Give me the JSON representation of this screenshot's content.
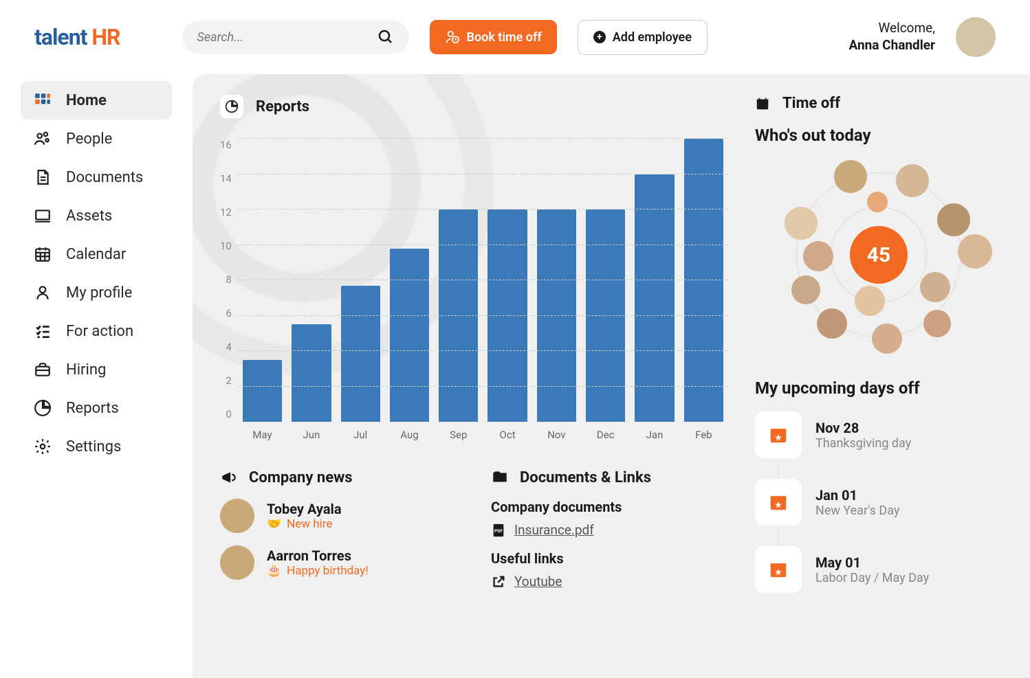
{
  "brand": {
    "part1": "talent",
    "part2": " HR"
  },
  "search": {
    "placeholder": "Search..."
  },
  "actions": {
    "book": "Book time off",
    "add": "Add employee"
  },
  "welcome": {
    "greeting": "Welcome,",
    "name": "Anna Chandler"
  },
  "nav": [
    {
      "label": "Home",
      "active": true
    },
    {
      "label": "People"
    },
    {
      "label": "Documents"
    },
    {
      "label": "Assets"
    },
    {
      "label": "Calendar"
    },
    {
      "label": "My profile"
    },
    {
      "label": "For action"
    },
    {
      "label": "Hiring"
    },
    {
      "label": "Reports"
    },
    {
      "label": "Settings"
    }
  ],
  "reports": {
    "title": "Reports"
  },
  "chart_data": {
    "type": "bar",
    "categories": [
      "May",
      "Jun",
      "Jul",
      "Aug",
      "Sep",
      "Oct",
      "Nov",
      "Dec",
      "Jan",
      "Feb"
    ],
    "values": [
      3.5,
      5.5,
      7.7,
      9.8,
      12,
      12,
      12,
      12,
      14,
      16
    ],
    "ylim": [
      0,
      16
    ],
    "yticks": [
      0,
      2,
      4,
      6,
      8,
      10,
      12,
      14,
      16
    ],
    "title": "Reports",
    "xlabel": "",
    "ylabel": ""
  },
  "timeoff": {
    "title": "Time off"
  },
  "whoout": {
    "title": "Who's out today",
    "count": "45"
  },
  "news": {
    "title": "Company news",
    "items": [
      {
        "name": "Tobey Ayala",
        "sub": "New hire",
        "icon": "handshake"
      },
      {
        "name": "Aarron Torres",
        "sub": "Happy birthday!",
        "icon": "cake"
      }
    ]
  },
  "docs": {
    "title": "Documents & Links",
    "group1": {
      "title": "Company documents",
      "link": "Insurance.pdf"
    },
    "group2": {
      "title": "Useful links",
      "link": "Youtube"
    }
  },
  "upcoming": {
    "title": "My upcoming days off",
    "items": [
      {
        "date": "Nov 28",
        "name": "Thanksgiving day"
      },
      {
        "date": "Jan 01",
        "name": "New Year's Day"
      },
      {
        "date": "May 01",
        "name": "Labor Day / May Day"
      }
    ]
  }
}
